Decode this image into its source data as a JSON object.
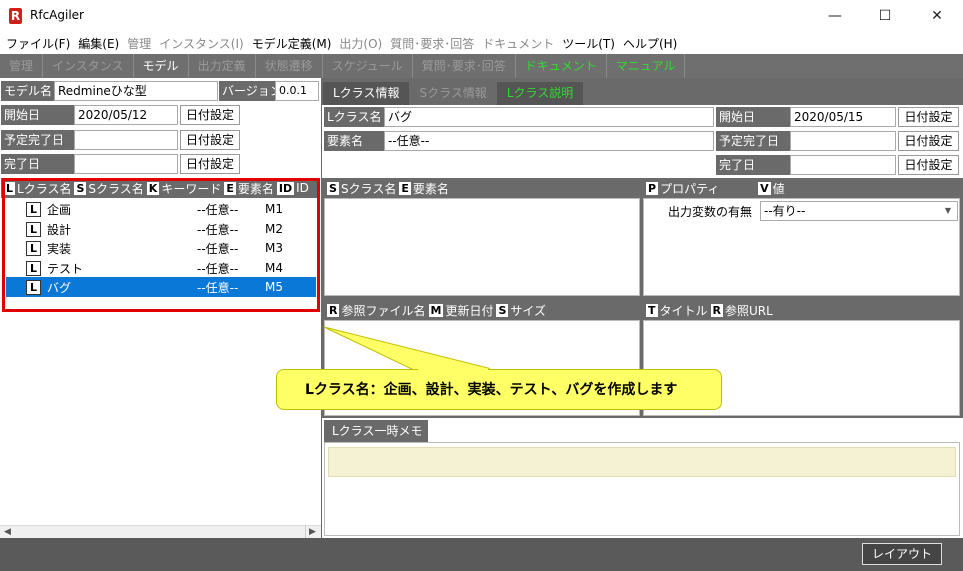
{
  "window": {
    "app_name": "RfcAgiler",
    "logo_letter": "R",
    "min": "—",
    "max": "☐",
    "close": "✕"
  },
  "menu": [
    "ファイル(F)",
    "編集(E)",
    "管理",
    "インスタンス(I)",
    "モデル定義(M)",
    "出力(O)",
    "質問･要求･回答",
    "ドキュメント",
    "ツール(T)",
    "ヘルプ(H)"
  ],
  "menu_dim": [
    false,
    false,
    true,
    true,
    false,
    true,
    true,
    true,
    false,
    false
  ],
  "tabs": [
    "管理",
    "インスタンス",
    "モデル",
    "出力定義",
    "状態遷移",
    "スケジュール",
    "質問･要求･回答",
    "ドキュメント",
    "マニュアル"
  ],
  "left": {
    "model_label": "モデル名",
    "model_value": "Redmineひな型",
    "version_label": "バージョン",
    "version_value": "0.0.1",
    "start_label": "開始日",
    "start_value": "2020/05/12",
    "plan_label": "予定完了日",
    "plan_value": "",
    "done_label": "完了日",
    "done_value": "",
    "date_btn": "日付設定",
    "tree_header": {
      "l": "L",
      "l_text": "Lクラス名",
      "s": "S",
      "s_text": "Sクラス名",
      "k": "K",
      "k_text": "キーワード",
      "e": "E",
      "e_text": "要素名",
      "id": "ID",
      "id_text": "ID"
    },
    "rows": [
      {
        "icon": "L",
        "name": "企画",
        "element": "--任意--",
        "id": "M1"
      },
      {
        "icon": "L",
        "name": "設計",
        "element": "--任意--",
        "id": "M2"
      },
      {
        "icon": "L",
        "name": "実装",
        "element": "--任意--",
        "id": "M3"
      },
      {
        "icon": "L",
        "name": "テスト",
        "element": "--任意--",
        "id": "M4"
      },
      {
        "icon": "L",
        "name": "バグ",
        "element": "--任意--",
        "id": "M5"
      }
    ]
  },
  "right": {
    "tabs": [
      "Lクラス情報",
      "Sクラス情報",
      "Lクラス説明"
    ],
    "lclass_label": "Lクラス名",
    "lclass_value": "バグ",
    "element_label": "要素名",
    "element_value": "--任意--",
    "start_label": "開始日",
    "start_value": "2020/05/15",
    "plan_label": "予定完了日",
    "plan_value": "",
    "done_label": "完了日",
    "done_value": "",
    "date_btn": "日付設定",
    "s_header": {
      "s": "S",
      "s_text": "Sクラス名",
      "e": "E",
      "e_text": "要素名"
    },
    "p_header": {
      "p": "P",
      "p_text": "プロパティ",
      "v": "V",
      "v_text": "値"
    },
    "prop_name": "出力変数の有無",
    "prop_value": "--有り--",
    "ref_header": {
      "r": "R",
      "r_text": "参照ファイル名",
      "m": "M",
      "m_text": "更新日付",
      "s": "S",
      "s_text": "サイズ"
    },
    "title_header": {
      "t": "T",
      "t_text": "タイトル",
      "r": "R",
      "r_text": "参照URL"
    },
    "memo_tab": "Lクラス一時メモ"
  },
  "callout": "Lクラス名：企画、設計、実装、テスト、バグを作成します",
  "status": {
    "layout_btn": "レイアウト"
  }
}
